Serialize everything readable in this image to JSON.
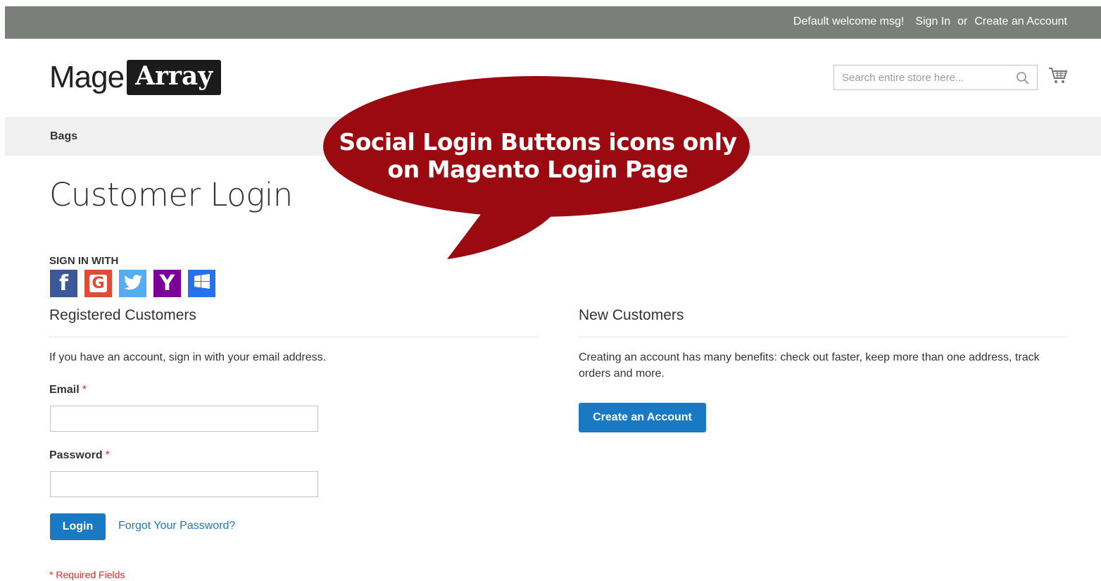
{
  "header": {
    "welcome": "Default welcome msg!",
    "sign_in": "Sign In",
    "or": "or",
    "create_account": "Create an Account"
  },
  "logo": {
    "part1": "Mage",
    "part2": "Array"
  },
  "search": {
    "placeholder": "Search entire store here..."
  },
  "nav": {
    "items": [
      "Bags"
    ]
  },
  "callout": {
    "line1": "Social Login Buttons icons only",
    "line2": "on Magento Login Page",
    "color": "#9b0a10"
  },
  "page_title": "Customer Login",
  "social": {
    "heading": "SIGN IN WITH",
    "providers": [
      {
        "name": "facebook",
        "glyph": "f",
        "color": "#3b5998"
      },
      {
        "name": "google",
        "glyph": "G",
        "color": "#dd4b39"
      },
      {
        "name": "twitter",
        "glyph": "",
        "color": "#55acee"
      },
      {
        "name": "yahoo",
        "glyph": "Y",
        "color": "#7b0099"
      },
      {
        "name": "windows",
        "glyph": "",
        "color": "#2672ec"
      }
    ]
  },
  "registered": {
    "title": "Registered Customers",
    "note": "If you have an account, sign in with your email address.",
    "email_label": "Email",
    "password_label": "Password",
    "required_mark": "*",
    "email_value": "",
    "password_value": "",
    "login_button": "Login",
    "forgot_link": "Forgot Your Password?"
  },
  "new_customers": {
    "title": "New Customers",
    "note": "Creating an account has many benefits: check out faster, keep more than one address, track orders and more.",
    "button": "Create an Account"
  },
  "required_fields": "* Required Fields",
  "colors": {
    "accent": "#1979c3",
    "topbar": "#7b7f7a",
    "required": "#e02b27"
  }
}
